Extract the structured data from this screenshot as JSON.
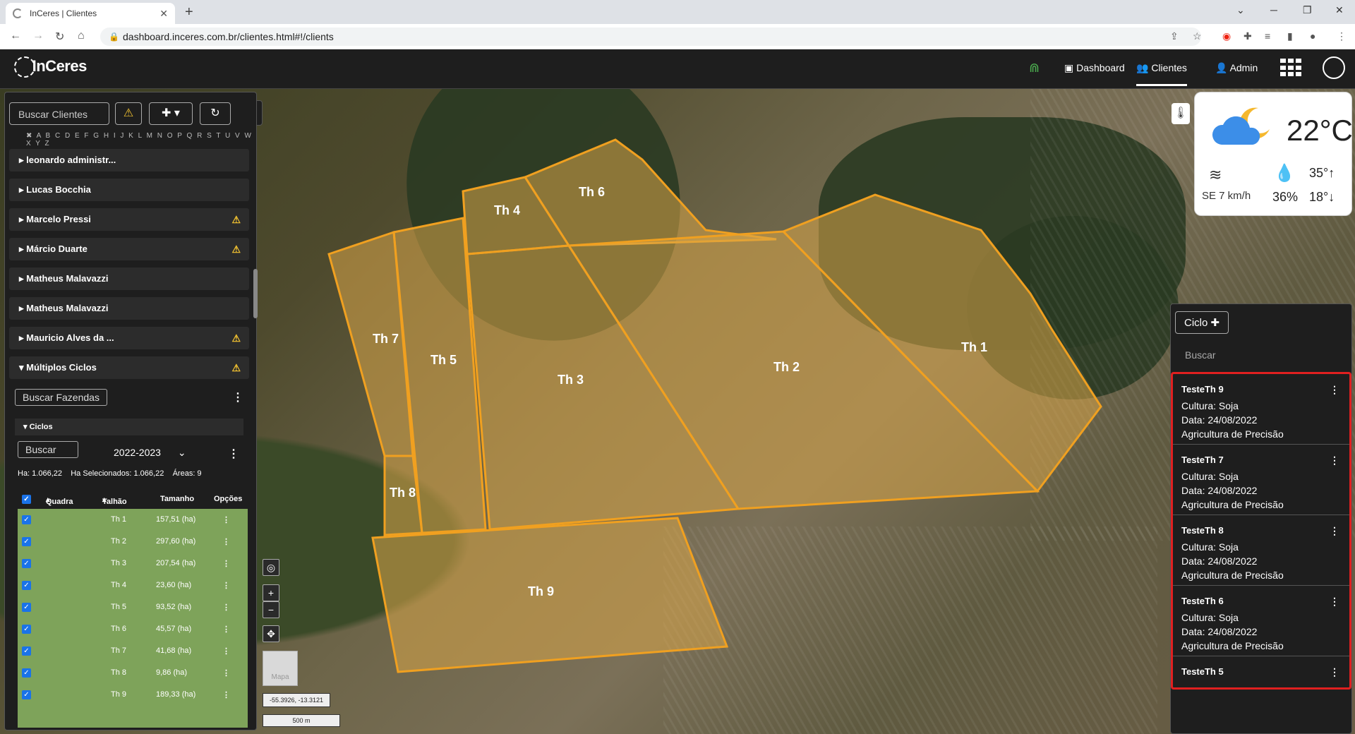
{
  "browser": {
    "tab_title": "InCeres | Clientes",
    "tab_close": "✕",
    "new_tab": "+",
    "url": "dashboard.inceres.com.br/clientes.html#!/clients"
  },
  "header": {
    "logo": "InCeres",
    "nav": [
      {
        "label": "Dashboard"
      },
      {
        "label": "Clientes"
      },
      {
        "label": "Admin"
      }
    ]
  },
  "left_panel": {
    "search_placeholder": "Buscar Clientes",
    "alphabet": "✖ A B C D E F G H I J K L M N O P Q R S T U V W X Y Z",
    "clients": [
      {
        "name": "leonardo administr...",
        "warning": false
      },
      {
        "name": "Lucas Bocchia",
        "warning": false
      },
      {
        "name": "Marcelo Pressi",
        "warning": true
      },
      {
        "name": "Márcio Duarte",
        "warning": true
      },
      {
        "name": "Matheus Malavazzi",
        "warning": false
      },
      {
        "name": "Matheus Malavazzi",
        "warning": false
      },
      {
        "name": "Mauricio Alves da ...",
        "warning": true
      },
      {
        "name": "Múltiplos Ciclos",
        "warning": true
      }
    ],
    "search_farms": "Buscar Fazendas",
    "ciclos_title": "Ciclos",
    "ciclos_search": "Buscar",
    "season": "2022-2023",
    "stats": {
      "ha": "Ha: 1.066,22",
      "ha_selected": "Ha Selecionados: 1.066,22",
      "areas": "Áreas: 9"
    },
    "table_headers": {
      "quadra": "Quadra",
      "talhao": "Talhão",
      "tamanho": "Tamanho",
      "opcoes": "Opções"
    },
    "rows": [
      {
        "talhao": "Th 1",
        "tamanho": "157,51 (ha)"
      },
      {
        "talhao": "Th 2",
        "tamanho": "297,60 (ha)"
      },
      {
        "talhao": "Th 3",
        "tamanho": "207,54 (ha)"
      },
      {
        "talhao": "Th 4",
        "tamanho": "23,60 (ha)"
      },
      {
        "talhao": "Th 5",
        "tamanho": "93,52 (ha)"
      },
      {
        "talhao": "Th 6",
        "tamanho": "45,57 (ha)"
      },
      {
        "talhao": "Th 7",
        "tamanho": "41,68 (ha)"
      },
      {
        "talhao": "Th 8",
        "tamanho": "9,86 (ha)"
      },
      {
        "talhao": "Th 9",
        "tamanho": "189,33 (ha)"
      }
    ]
  },
  "map": {
    "fields": [
      "Th 1",
      "Th 2",
      "Th 3",
      "Th 4",
      "Th 5",
      "Th 6",
      "Th 7",
      "Th 8",
      "Th 9"
    ],
    "thumb_label": "Mapa",
    "coords": "-55.3926, -13.3121",
    "scale": "500 m",
    "field_color": "#d9a648"
  },
  "weather": {
    "temp": "22°C",
    "max": "35°",
    "min": "18°",
    "humidity": "36%",
    "wind": "SE 7 km/h"
  },
  "right_panel": {
    "ciclo_button": "Ciclo",
    "search_placeholder": "Buscar",
    "cards": [
      {
        "title": "TesteTh 9",
        "cultura": "Cultura: Soja",
        "data": "Data: 24/08/2022",
        "tipo": "Agricultura de Precisão"
      },
      {
        "title": "TesteTh 7",
        "cultura": "Cultura: Soja",
        "data": "Data: 24/08/2022",
        "tipo": "Agricultura de Precisão"
      },
      {
        "title": "TesteTh 8",
        "cultura": "Cultura: Soja",
        "data": "Data: 24/08/2022",
        "tipo": "Agricultura de Precisão"
      },
      {
        "title": "TesteTh 6",
        "cultura": "Cultura: Soja",
        "data": "Data: 24/08/2022",
        "tipo": "Agricultura de Precisão"
      },
      {
        "title": "TesteTh 5"
      }
    ],
    "highlight_color": "#e02020"
  }
}
